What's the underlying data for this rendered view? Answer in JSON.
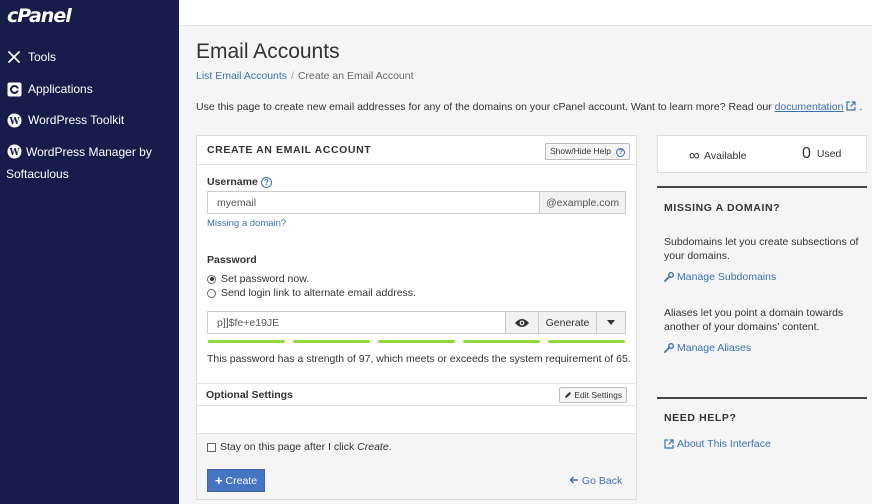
{
  "sidebar": {
    "logo": "cPanel",
    "items": [
      {
        "label": "Tools"
      },
      {
        "label": "Applications"
      },
      {
        "label": "WordPress Toolkit"
      },
      {
        "label": "WordPress Manager by Softaculous"
      }
    ]
  },
  "page": {
    "title": "Email Accounts",
    "breadcrumb": {
      "parent": "List Email Accounts",
      "separator": "/",
      "current": "Create an Email Account"
    },
    "intro_text": "Use this page to create new email addresses for any of the domains on your cPanel account. Want to learn more? Read our ",
    "intro_link": "documentation",
    "intro_end": "."
  },
  "form": {
    "heading": "CREATE AN EMAIL ACCOUNT",
    "help_toggle": "Show/Hide Help",
    "username_label": "Username",
    "username_value": "myemail",
    "domain_addon": "@example.com",
    "missing_domain_link": "Missing a domain?",
    "password_label": "Password",
    "radio_set_now": "Set password now.",
    "radio_send_link": "Send login link to alternate email address.",
    "password_value": "p]]$fe+e19JE",
    "generate_label": "Generate",
    "strength_text": "This password has a strength of 97, which meets or exceeds the system requirement of 65.",
    "strength_value": 97,
    "strength_color": "#8fd93a",
    "optional_heading": "Optional Settings",
    "edit_settings": "Edit Settings",
    "stay_label_prefix": "Stay on this page after I click ",
    "stay_label_em": "Create",
    "stay_label_suffix": ".",
    "create_label": "Create",
    "go_back_label": "Go Back"
  },
  "stats": {
    "available_symbol": "∞",
    "available_label": "Available",
    "used_count": "0",
    "used_label": "Used"
  },
  "help_sidebar": {
    "missing_heading": "MISSING A DOMAIN?",
    "subdomains_text": "Subdomains let you create subsections of your domains.",
    "subdomains_link": "Manage Subdomains",
    "aliases_text": "Aliases let you point a domain towards another of your domains’ content.",
    "aliases_link": "Manage Aliases",
    "need_help_heading": "NEED HELP?",
    "about_link": "About This Interface"
  },
  "colors": {
    "sidebar_bg": "#181c4a",
    "link": "#3a72b5",
    "primary_button": "#4474c2",
    "strength_bar": "#8fd93a"
  }
}
